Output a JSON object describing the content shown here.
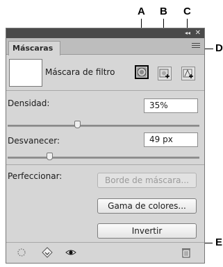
{
  "callouts": {
    "a": "A",
    "b": "B",
    "c": "C",
    "d": "D",
    "e": "E"
  },
  "panel": {
    "tab_label": "Máscaras",
    "titlebar": {
      "collapse_glyph": "◂◂",
      "close_glyph": "✕"
    },
    "mask_label": "Máscara de filtro",
    "density": {
      "label": "Densidad:",
      "value": "35%",
      "level": 0.35
    },
    "feather": {
      "label": "Desvanecer:",
      "value": "49 px",
      "level": 0.2
    },
    "refine": {
      "label": "Perfeccionar:"
    },
    "buttons": {
      "mask_edge": "Borde de máscara...",
      "color_range": "Gama de colores...",
      "invert": "Invertir"
    },
    "icons": {
      "pixel_mask": "pixel-mask-icon",
      "add_pixel_mask": "add-pixel-mask-icon",
      "add_vector_mask": "add-vector-mask-icon",
      "panel_menu": "panel-menu-icon",
      "load_selection": "load-selection-icon",
      "apply_mask": "apply-mask-icon",
      "toggle_visibility": "eye-icon",
      "delete": "trash-icon"
    }
  }
}
